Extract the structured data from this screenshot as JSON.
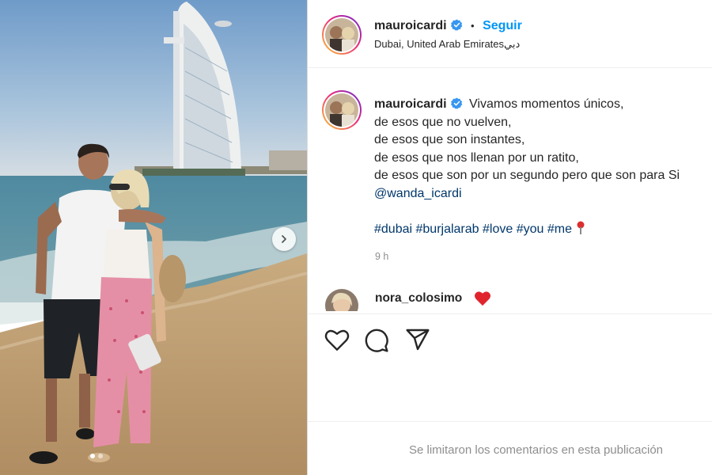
{
  "post": {
    "username": "mauroicardi",
    "verified": true,
    "separator": "•",
    "follow_label": "Seguir",
    "location": "Dubai, United Arab Emiratesدبي",
    "caption_lines": [
      "Vivamos momentos únicos,",
      "de esos que no vuelven,",
      "de esos que son instantes,",
      "de esos que nos llenan por un ratito,",
      "de esos que son por un segundo pero que son para Si"
    ],
    "mention": "@wanda_icardi",
    "hashtags": [
      "#dubai",
      "#burjalarab",
      "#love",
      "#you",
      "#me"
    ],
    "hashtag_emoji": "📍",
    "time": "9 h"
  },
  "comment": {
    "username": "nora_colosimo",
    "emoji": "heart"
  },
  "footer": {
    "comments_limited": "Se limitaron los comentarios en esta publicación"
  },
  "carousel": {
    "slide": 1,
    "slides": 2
  },
  "icons": [
    "chevron-right-icon",
    "verified-badge-icon",
    "heart-icon",
    "comment-icon",
    "share-icon",
    "red-heart-icon",
    "pin-icon"
  ],
  "colors": {
    "follow": "#0095f6",
    "link": "#00376b",
    "verified": "#3897f0",
    "muted": "#8e8e8e"
  }
}
